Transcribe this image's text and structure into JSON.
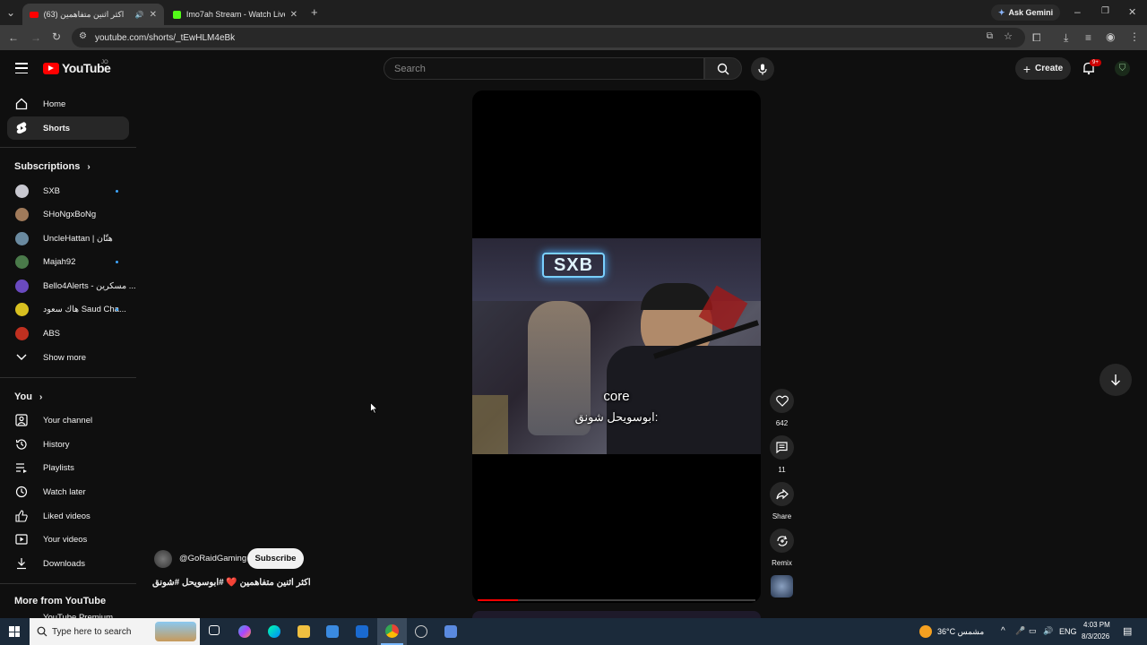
{
  "browser": {
    "tabs": [
      {
        "title": "اكثر اثنين متفاهمين (63)",
        "active": true
      },
      {
        "title": "Imo7ah Stream - Watch Live on",
        "active": false
      }
    ],
    "url": "youtube.com/shorts/_tEwHLM4eBk",
    "ask_gemini": "Ask Gemini"
  },
  "header": {
    "logo_text": "YouTube",
    "country_code": "JO",
    "search_placeholder": "Search",
    "create_label": "Create",
    "notif_badge": "9+"
  },
  "sidebar": {
    "main": [
      {
        "label": "Home",
        "icon": "home-icon"
      },
      {
        "label": "Shorts",
        "icon": "shorts-icon",
        "active": true
      }
    ],
    "subscriptions_title": "Subscriptions",
    "subscriptions": [
      {
        "label": "SXB",
        "dot": true,
        "color": "#c8c8d0"
      },
      {
        "label": "SHoNgxBoNg",
        "dot": false,
        "color": "#a07a5a"
      },
      {
        "label": "UncleHattan | هتّان",
        "dot": false,
        "color": "#6a8aa0"
      },
      {
        "label": "Majah92",
        "dot": true,
        "color": "#4a7a4a"
      },
      {
        "label": "Bello4Alerts - مسكرين ...",
        "dot": false,
        "color": "#6a4ac0"
      },
      {
        "label": "هاك سعود Saud Cha...",
        "dot": true,
        "color": "#d8c020"
      },
      {
        "label": "ABS",
        "dot": false,
        "color": "#c03020"
      }
    ],
    "show_more": "Show more",
    "you_title": "You",
    "you_items": [
      {
        "label": "Your channel",
        "icon": "channel-icon"
      },
      {
        "label": "History",
        "icon": "history-icon"
      },
      {
        "label": "Playlists",
        "icon": "playlists-icon"
      },
      {
        "label": "Watch later",
        "icon": "watch-later-icon"
      },
      {
        "label": "Liked videos",
        "icon": "like-icon"
      },
      {
        "label": "Your videos",
        "icon": "your-videos-icon"
      },
      {
        "label": "Downloads",
        "icon": "download-icon"
      }
    ],
    "more_title": "More from YouTube",
    "more_first": "YouTube Premium"
  },
  "video": {
    "channel": "@GoRaidGaming",
    "subscribe": "Subscribe",
    "title": "اكثر اثنين متفاهمين ❤️ #ابوسويحل #شونق",
    "caption_top": "core",
    "caption_bottom": "ابوسويحل شونق:",
    "sign_text": "SXB",
    "progress": 0.145,
    "likes": "642",
    "comments": "11",
    "share_label": "Share",
    "remix_label": "Remix"
  },
  "taskbar": {
    "search_placeholder": "Type here to search",
    "weather": "36°C  مشمس",
    "lang": "ENG",
    "time": "4:03 PM",
    "date": "8/3/2026"
  }
}
